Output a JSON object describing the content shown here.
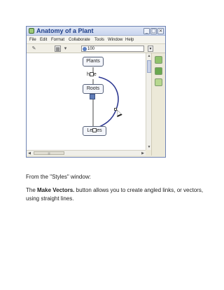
{
  "window": {
    "title": "Anatomy of a Plant",
    "controls": {
      "minimize": "_",
      "maximize": "□",
      "close": "×"
    }
  },
  "menu": {
    "items": [
      "File",
      "Edit",
      "Format",
      "Collaborate",
      "Tools",
      "Window",
      "Help"
    ]
  },
  "toolbar": {
    "zoom_value": "100",
    "icons": [
      "cursor-tool-icon",
      "style-tool-icon",
      "zoom-icon",
      "dropdown-arrow-icon"
    ]
  },
  "concept_map": {
    "nodes": {
      "plants": "Plants",
      "roots": "Roots",
      "leaves_prefix": "Le",
      "leaves_suffix": "es"
    },
    "link_label_prefix": "h",
    "link_label_suffix": "e"
  },
  "side_panel": {
    "buttons": [
      "green-add-icon",
      "green-concept-icon",
      "green-link-icon"
    ]
  },
  "text": {
    "intro": "From the \"Styles\" window:",
    "make_vectors": "Make Vectors.",
    "description_rest": " button allows you to create angled links, or vectors, using straight lines.",
    "the": "The "
  },
  "colors": {
    "window_border": "#6f84b4",
    "title_text": "#1f3f8a",
    "link_curve": "#2f3a93",
    "node_border": "#58627a"
  }
}
